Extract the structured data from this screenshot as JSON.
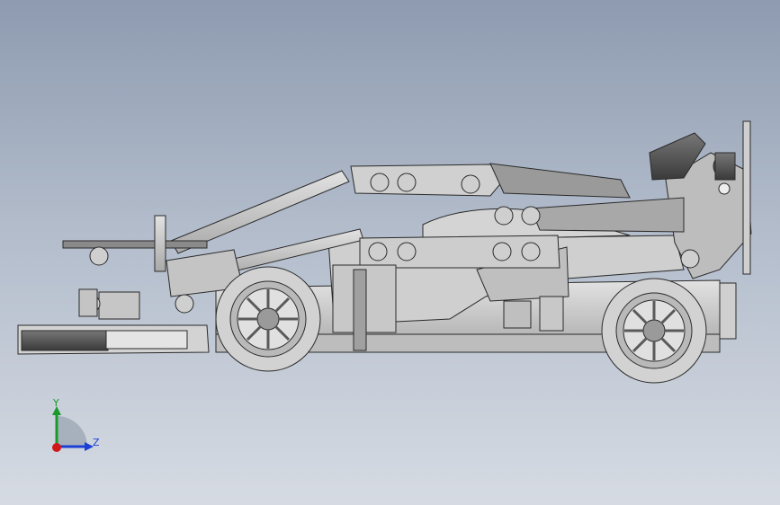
{
  "viewport": {
    "background_top": "#8e9bb0",
    "background_bottom": "#d6dbe3",
    "model_fill": "#c9c9c9",
    "model_stroke": "#2a2a2a"
  },
  "triad": {
    "y_label": "Y",
    "z_label": "Z",
    "y_color": "#1a9a2a",
    "z_color": "#1b3fd6",
    "origin_color": "#d01818"
  }
}
